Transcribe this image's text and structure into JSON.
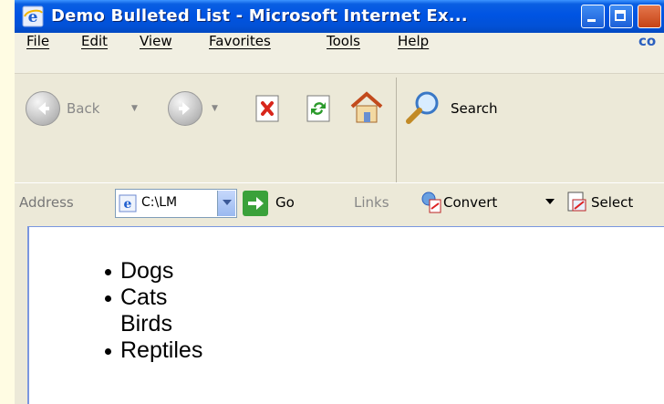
{
  "window": {
    "title": "Demo Bulleted List - Microsoft Internet Ex..."
  },
  "menubar": {
    "items": [
      "File",
      "Edit",
      "View",
      "Favorites",
      "Tools",
      "Help"
    ],
    "brand_fragment": "co"
  },
  "toolbar": {
    "back_label": "Back",
    "search_label": "Search"
  },
  "addressbar": {
    "address_label": "Address",
    "address_value": "C:\\LM",
    "go_label": "Go",
    "links_label": "Links",
    "convert_label": "Convert",
    "select_label": "Select"
  },
  "page": {
    "list_items": [
      {
        "text": "Dogs",
        "bullet": true
      },
      {
        "text": "Cats",
        "bullet": true
      },
      {
        "text": "Birds",
        "bullet": false
      },
      {
        "text": "Reptiles",
        "bullet": true
      }
    ]
  },
  "colors": {
    "titlebar": "#0054e3",
    "chrome": "#ece9d8",
    "desktop": "#fffce3"
  }
}
